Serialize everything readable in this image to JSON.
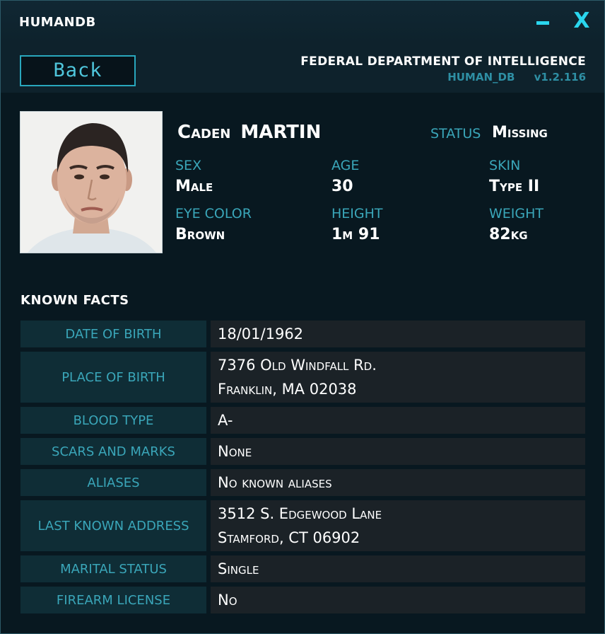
{
  "app": {
    "title": "HUMANDB",
    "minimize_label": "–",
    "close_label": "X"
  },
  "header": {
    "back_label": "Back",
    "agency": "FEDERAL DEPARTMENT OF INTELLIGENCE",
    "db_name": "HUMAN_DB",
    "version": "v1.2.116"
  },
  "person": {
    "first_name": "Caden",
    "last_name": "MARTIN",
    "status_label": "STATUS",
    "status_value": "Missing",
    "attributes": [
      {
        "label": "SEX",
        "value": "Male"
      },
      {
        "label": "AGE",
        "value": "30"
      },
      {
        "label": "SKIN",
        "value": "Type II"
      },
      {
        "label": "EYE COLOR",
        "value": "Brown"
      },
      {
        "label": "HEIGHT",
        "value": "1m 91"
      },
      {
        "label": "WEIGHT",
        "value": "82kg"
      }
    ]
  },
  "facts": {
    "title": "KNOWN  FACTS",
    "rows": [
      {
        "label": "DATE OF BIRTH",
        "value": [
          "18/01/1962"
        ]
      },
      {
        "label": "PLACE OF BIRTH",
        "value": [
          "7376 Old Windfall Rd.",
          "Franklin, MA 02038"
        ]
      },
      {
        "label": "BLOOD TYPE",
        "value": [
          "A-"
        ]
      },
      {
        "label": "SCARS AND MARKS",
        "value": [
          "None"
        ]
      },
      {
        "label": "ALIASES",
        "value": [
          "No known aliases"
        ]
      },
      {
        "label": "LAST KNOWN ADDRESS",
        "value": [
          "3512 S. Edgewood Lane",
          "Stamford, CT 06902"
        ]
      },
      {
        "label": "MARITAL STATUS",
        "value": [
          "Single"
        ]
      },
      {
        "label": "FIREARM LICENSE",
        "value": [
          "No"
        ]
      }
    ]
  },
  "colors": {
    "accent": "#2ad6ee",
    "label": "#3aa6b9",
    "background": "#081820"
  }
}
